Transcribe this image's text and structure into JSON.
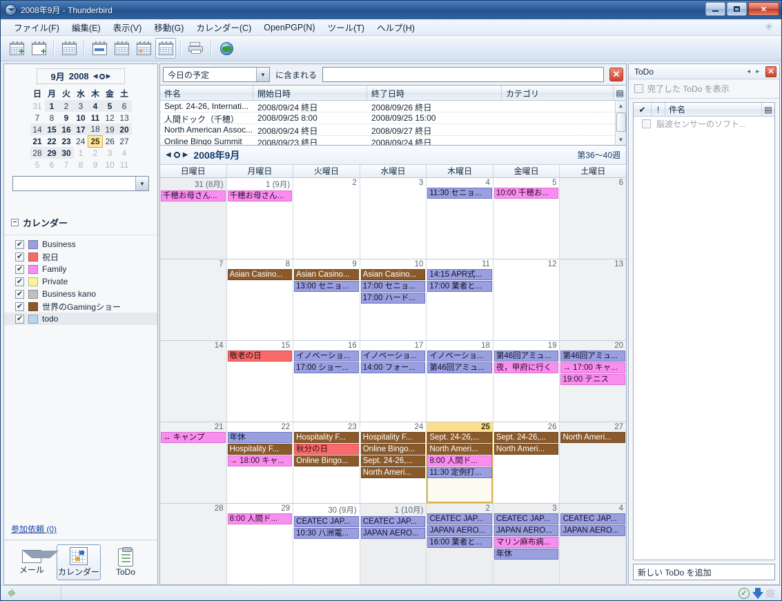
{
  "window": {
    "title": "2008年9月 - Thunderbird",
    "minimize_label": "—",
    "maximize_label": "□",
    "close_label": "✕"
  },
  "menubar": {
    "items": [
      {
        "label": "ファイル(F)"
      },
      {
        "label": "編集(E)"
      },
      {
        "label": "表示(V)"
      },
      {
        "label": "移動(G)"
      },
      {
        "label": "カレンダー(C)"
      },
      {
        "label": "OpenPGP(N)"
      },
      {
        "label": "ツール(T)"
      },
      {
        "label": "ヘルプ(H)"
      }
    ]
  },
  "toolbar": {
    "buttons": [
      {
        "name": "new-event-button",
        "icon": "calendar-plus-icon"
      },
      {
        "name": "new-task-button",
        "icon": "task-plus-icon"
      },
      {
        "name": "subscribe-button",
        "icon": "calendar-download-icon"
      },
      {
        "name": "day-view-button",
        "icon": "calendar-day-icon"
      },
      {
        "name": "week-view-button",
        "icon": "calendar-week-icon"
      },
      {
        "name": "multiweek-view-button",
        "icon": "calendar-multiweek-icon"
      },
      {
        "name": "month-view-button",
        "icon": "calendar-month-icon"
      },
      {
        "name": "print-button",
        "icon": "printer-icon"
      },
      {
        "name": "publish-button",
        "icon": "globe-icon"
      }
    ]
  },
  "minicalendar": {
    "month_label": "9月",
    "year_label": "2008",
    "weekday_headers": [
      "日",
      "月",
      "火",
      "水",
      "木",
      "金",
      "土"
    ],
    "rows": [
      [
        {
          "d": "31",
          "cls": "other"
        },
        {
          "d": "1",
          "cls": "inmonth bold"
        },
        {
          "d": "2",
          "cls": "inmonth"
        },
        {
          "d": "3",
          "cls": "inmonth"
        },
        {
          "d": "4",
          "cls": "inmonth bold"
        },
        {
          "d": "5",
          "cls": "inmonth bold"
        },
        {
          "d": "6",
          "cls": "inmonth"
        }
      ],
      [
        {
          "d": "7",
          "cls": ""
        },
        {
          "d": "8",
          "cls": ""
        },
        {
          "d": "9",
          "cls": "bold"
        },
        {
          "d": "10",
          "cls": "bold"
        },
        {
          "d": "11",
          "cls": "bold"
        },
        {
          "d": "12",
          "cls": ""
        },
        {
          "d": "13",
          "cls": ""
        }
      ],
      [
        {
          "d": "14",
          "cls": "inmonth"
        },
        {
          "d": "15",
          "cls": "inmonth bold"
        },
        {
          "d": "16",
          "cls": "inmonth bold"
        },
        {
          "d": "17",
          "cls": "inmonth bold"
        },
        {
          "d": "18",
          "cls": "inmonth"
        },
        {
          "d": "19",
          "cls": "inmonth"
        },
        {
          "d": "20",
          "cls": "inmonth bold"
        }
      ],
      [
        {
          "d": "21",
          "cls": "bold"
        },
        {
          "d": "22",
          "cls": "bold"
        },
        {
          "d": "23",
          "cls": "bold"
        },
        {
          "d": "24",
          "cls": ""
        },
        {
          "d": "25",
          "cls": "today"
        },
        {
          "d": "26",
          "cls": ""
        },
        {
          "d": "27",
          "cls": ""
        }
      ],
      [
        {
          "d": "28",
          "cls": "inmonth"
        },
        {
          "d": "29",
          "cls": "inmonth bold"
        },
        {
          "d": "30",
          "cls": "inmonth bold"
        },
        {
          "d": "1",
          "cls": "other"
        },
        {
          "d": "2",
          "cls": "other"
        },
        {
          "d": "3",
          "cls": "other"
        },
        {
          "d": "4",
          "cls": "other"
        }
      ],
      [
        {
          "d": "5",
          "cls": "other"
        },
        {
          "d": "6",
          "cls": "other"
        },
        {
          "d": "7",
          "cls": "other"
        },
        {
          "d": "8",
          "cls": "other"
        },
        {
          "d": "9",
          "cls": "other"
        },
        {
          "d": "10",
          "cls": "other"
        },
        {
          "d": "11",
          "cls": "other"
        }
      ]
    ],
    "date_field_value": ""
  },
  "calendars_section": {
    "title": "カレンダー",
    "twisty": "−",
    "items": [
      {
        "label": "Business",
        "color": "#9a9fe0",
        "checked": true,
        "selected": false
      },
      {
        "label": "祝日",
        "color": "#f96a6a",
        "checked": true,
        "selected": false
      },
      {
        "label": "Family",
        "color": "#f98ef0",
        "checked": true,
        "selected": false
      },
      {
        "label": "Private",
        "color": "#f9f59a",
        "checked": true,
        "selected": false
      },
      {
        "label": "Business kano",
        "color": "#c0c0c0",
        "checked": true,
        "selected": false
      },
      {
        "label": "世界のGamingショー",
        "color": "#8b5a2b",
        "checked": true,
        "selected": false
      },
      {
        "label": "todo",
        "color": "#b9d4ec",
        "checked": true,
        "selected": true
      }
    ]
  },
  "sidebar_bottom": {
    "invite_link": "参加依頼 (0)",
    "modes": [
      {
        "label": "メール",
        "icon": "mail-icon",
        "active": false
      },
      {
        "label": "カレンダー",
        "icon": "calendar-icon",
        "active": true
      },
      {
        "label": "ToDo",
        "icon": "todo-icon",
        "active": false
      }
    ]
  },
  "search": {
    "filter_value": "今日の予定",
    "contains_label": "に含まれる",
    "input_value": "",
    "clear_label": "✕"
  },
  "event_list": {
    "columns": [
      "件名",
      "開始日時",
      "終了日時",
      "カテゴリ"
    ],
    "rows": [
      {
        "subject": "Sept. 24-26, Internati...",
        "start": "2008/09/24 終日",
        "end": "2008/09/26 終日",
        "category": ""
      },
      {
        "subject": "人間ドック（千穂）",
        "start": "2008/09/25 8:00",
        "end": "2008/09/25 15:00",
        "category": ""
      },
      {
        "subject": "North American Assoc...",
        "start": "2008/09/24 終日",
        "end": "2008/09/27 終日",
        "category": ""
      },
      {
        "subject": "Online Bingo Summit",
        "start": "2008/09/23 終日",
        "end": "2008/09/24 終日",
        "category": ""
      }
    ]
  },
  "monthview": {
    "title": "2008年9月",
    "weeks_label": "第36～40週",
    "weekday_headers": [
      "日曜日",
      "月曜日",
      "火曜日",
      "水曜日",
      "木曜日",
      "金曜日",
      "土曜日"
    ],
    "weeks": [
      [
        {
          "num": "31 (8月)",
          "state": "off",
          "events": [
            {
              "text": "千穂お母さん...",
              "cal": "family"
            }
          ]
        },
        {
          "num": "1 (9月)",
          "state": "",
          "events": [
            {
              "text": "千穂お母さん...",
              "cal": "family"
            }
          ]
        },
        {
          "num": "2",
          "state": "",
          "events": []
        },
        {
          "num": "3",
          "state": "",
          "events": []
        },
        {
          "num": "4",
          "state": "",
          "events": [
            {
              "text": "11:30 セニョ...",
              "cal": "business"
            }
          ]
        },
        {
          "num": "5",
          "state": "",
          "events": [
            {
              "text": "10:00 千穂お...",
              "cal": "family"
            }
          ]
        },
        {
          "num": "6",
          "state": "weekendish",
          "events": []
        }
      ],
      [
        {
          "num": "7",
          "state": "weekendish",
          "events": []
        },
        {
          "num": "8",
          "state": "",
          "events": [
            {
              "text": "Asian Casino...",
              "cal": "gaming"
            }
          ]
        },
        {
          "num": "9",
          "state": "",
          "events": [
            {
              "text": "Asian Casino...",
              "cal": "gaming"
            },
            {
              "text": "13:00 セニョ...",
              "cal": "business"
            }
          ]
        },
        {
          "num": "10",
          "state": "",
          "events": [
            {
              "text": "Asian Casino...",
              "cal": "gaming"
            },
            {
              "text": "17:00 セニョ...",
              "cal": "business"
            },
            {
              "text": "17:00 ハード...",
              "cal": "business"
            }
          ]
        },
        {
          "num": "11",
          "state": "",
          "events": [
            {
              "text": "14:15 APR式...",
              "cal": "business"
            },
            {
              "text": "17:00 業者と...",
              "cal": "business"
            }
          ]
        },
        {
          "num": "12",
          "state": "",
          "events": []
        },
        {
          "num": "13",
          "state": "weekendish",
          "events": []
        }
      ],
      [
        {
          "num": "14",
          "state": "weekendish",
          "events": []
        },
        {
          "num": "15",
          "state": "",
          "events": [
            {
              "text": "敬老の日",
              "cal": "holiday"
            }
          ]
        },
        {
          "num": "16",
          "state": "",
          "events": [
            {
              "text": "イノベーショ...",
              "cal": "business"
            },
            {
              "text": "17:00 ショー...",
              "cal": "business"
            }
          ]
        },
        {
          "num": "17",
          "state": "",
          "events": [
            {
              "text": "イノベーショ...",
              "cal": "business"
            },
            {
              "text": "14:00 フォー...",
              "cal": "business"
            }
          ]
        },
        {
          "num": "18",
          "state": "",
          "events": [
            {
              "text": "イノベーショ...",
              "cal": "business"
            },
            {
              "text": "第46回アミュ...",
              "cal": "business"
            }
          ]
        },
        {
          "num": "19",
          "state": "",
          "events": [
            {
              "text": "第46回アミュ...",
              "cal": "business"
            },
            {
              "text": "夜，甲府に行く",
              "cal": "family"
            }
          ]
        },
        {
          "num": "20",
          "state": "weekendish",
          "events": [
            {
              "text": "第46回アミュ...",
              "cal": "business"
            },
            {
              "text": "→ 17:00 キャ...",
              "cal": "family"
            },
            {
              "text": "19:00 テニス",
              "cal": "family"
            }
          ]
        }
      ],
      [
        {
          "num": "21",
          "state": "weekendish",
          "events": [
            {
              "text": "↔ キャンプ",
              "cal": "family"
            }
          ]
        },
        {
          "num": "22",
          "state": "",
          "events": [
            {
              "text": "年休",
              "cal": "business"
            },
            {
              "text": "Hospitality F...",
              "cal": "gaming"
            },
            {
              "text": "→ 18:00 キャ...",
              "cal": "family"
            }
          ]
        },
        {
          "num": "23",
          "state": "",
          "events": [
            {
              "text": "Hospitality F...",
              "cal": "gaming"
            },
            {
              "text": "秋分の日",
              "cal": "holiday"
            },
            {
              "text": "Online Bingo...",
              "cal": "gaming"
            }
          ]
        },
        {
          "num": "24",
          "state": "",
          "events": [
            {
              "text": "Hospitality F...",
              "cal": "gaming"
            },
            {
              "text": "Online Bingo...",
              "cal": "gaming"
            },
            {
              "text": "Sept. 24-26,...",
              "cal": "gaming"
            },
            {
              "text": "North Ameri...",
              "cal": "gaming"
            }
          ]
        },
        {
          "num": "25",
          "state": "today",
          "events": [
            {
              "text": "Sept. 24-26,...",
              "cal": "gaming"
            },
            {
              "text": "North Ameri...",
              "cal": "gaming"
            },
            {
              "text": "8:00 人間ド...",
              "cal": "family"
            },
            {
              "text": "11:30 定例打...",
              "cal": "business"
            }
          ]
        },
        {
          "num": "26",
          "state": "",
          "events": [
            {
              "text": "Sept. 24-26,...",
              "cal": "gaming"
            },
            {
              "text": "North Ameri...",
              "cal": "gaming"
            }
          ]
        },
        {
          "num": "27",
          "state": "weekendish",
          "events": [
            {
              "text": "North Ameri...",
              "cal": "gaming"
            }
          ]
        }
      ],
      [
        {
          "num": "28",
          "state": "weekendish",
          "events": []
        },
        {
          "num": "29",
          "state": "",
          "events": [
            {
              "text": "8:00 人間ド...",
              "cal": "family"
            }
          ]
        },
        {
          "num": "30 (9月)",
          "state": "",
          "events": [
            {
              "text": "CEATEC JAP...",
              "cal": "business"
            },
            {
              "text": "10:30 八洲電...",
              "cal": "business"
            }
          ]
        },
        {
          "num": "1 (10月)",
          "state": "off",
          "events": [
            {
              "text": "CEATEC JAP...",
              "cal": "business"
            },
            {
              "text": "JAPAN AERO...",
              "cal": "business"
            }
          ]
        },
        {
          "num": "2",
          "state": "off",
          "events": [
            {
              "text": "CEATEC JAP...",
              "cal": "business"
            },
            {
              "text": "JAPAN AERO...",
              "cal": "business"
            },
            {
              "text": "16:00 業者と...",
              "cal": "business"
            }
          ]
        },
        {
          "num": "3",
          "state": "off",
          "events": [
            {
              "text": "CEATEC JAP...",
              "cal": "business"
            },
            {
              "text": "JAPAN AERO...",
              "cal": "business"
            },
            {
              "text": "マリン麻布病...",
              "cal": "family"
            },
            {
              "text": "年休",
              "cal": "business"
            }
          ]
        },
        {
          "num": "4",
          "state": "off",
          "events": [
            {
              "text": "CEATEC JAP...",
              "cal": "business"
            },
            {
              "text": "JAPAN AERO...",
              "cal": "business"
            }
          ]
        }
      ]
    ]
  },
  "todopanel": {
    "title": "ToDo",
    "close_label": "✕",
    "show_completed_label": "完了した ToDo を表示",
    "columns": {
      "check": "✔",
      "priority": "!",
      "name": "件名"
    },
    "items": [
      {
        "label": "脳波センサーのソフト...",
        "done": false
      }
    ],
    "new_todo_placeholder": "新しい ToDo を追加"
  },
  "statusbar": {
    "offline_icon": "wifi-icon",
    "icons": [
      "check-circle-icon",
      "download-arrow-icon"
    ]
  }
}
